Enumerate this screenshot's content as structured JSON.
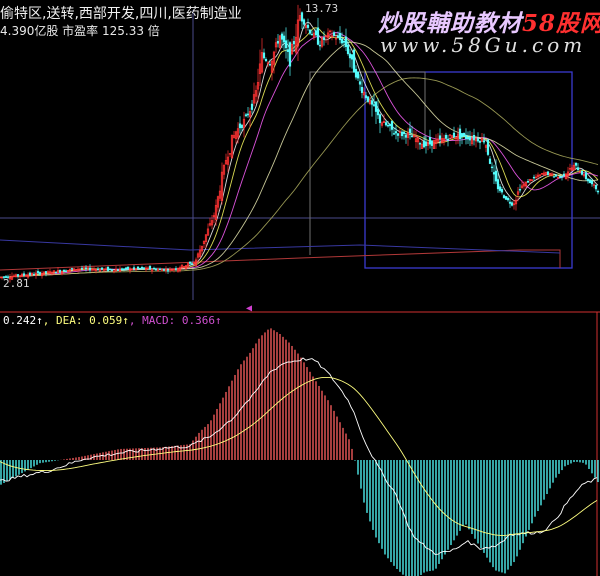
{
  "header": {
    "concepts": "偷特区,送转,西部开发,四川,医药制造业",
    "capital": "4.390亿股 市盈率 125.33 倍"
  },
  "watermark": {
    "brand_prefix": "炒股輔助教材",
    "brand_suffix": "58股网",
    "url": "www.58Gu.com",
    "prefix_color": "#e8c8ff",
    "suffix_color": "#ff3030",
    "url_color": "#e0e0e0"
  },
  "price_labels": {
    "high": "13.73",
    "low": "2.81"
  },
  "macd_legend": [
    {
      "text": "0.242↑",
      "color": "#ffffff"
    },
    {
      "text": ", DEA: 0.059↑",
      "color": "#ffff80"
    },
    {
      "text": ", MACD: 0.366↑",
      "color": "#d050d0"
    }
  ],
  "colors": {
    "background": "#000000",
    "up_candle": "#ff3232",
    "down_candle": "#54fcfc",
    "macd_positive": "#ff6060",
    "macd_negative": "#54fcfc",
    "dif_line": "#ffffff",
    "dea_line": "#ffff80",
    "separator": "#d03030",
    "marker": "#d040d0"
  },
  "chart_data": [
    {
      "type": "line",
      "panel": "candlestick price",
      "y_high": 13.73,
      "y_low": 2.81,
      "x": [
        0,
        25,
        50,
        80,
        110,
        140,
        170,
        195,
        205,
        215,
        225,
        235,
        245,
        255,
        262,
        270,
        280,
        290,
        300,
        310,
        320,
        330,
        345,
        360,
        370,
        380,
        395,
        410,
        425,
        440,
        455,
        470,
        485,
        495,
        505,
        513,
        520,
        530,
        545,
        560,
        575,
        590,
        598
      ],
      "series": [
        {
          "values": [
            3.0,
            3.1,
            3.2,
            3.35,
            3.3,
            3.35,
            3.3,
            3.6,
            4.6,
            5.6,
            7.6,
            8.8,
            9.3,
            10.2,
            11.9,
            11.6,
            12.7,
            11.7,
            13.5,
            12.9,
            12.4,
            12.8,
            12.4,
            10.7,
            10.0,
            9.3,
            8.8,
            8.7,
            8.3,
            8.5,
            8.7,
            8.6,
            8.5,
            6.8,
            6.2,
            5.9,
            6.6,
            6.9,
            7.2,
            7.0,
            7.5,
            6.8,
            6.5
          ]
        }
      ]
    },
    {
      "type": "bar",
      "panel": "MACD histogram",
      "x": [
        0,
        40,
        80,
        120,
        160,
        190,
        200,
        210,
        220,
        230,
        240,
        250,
        260,
        270,
        280,
        290,
        300,
        310,
        320,
        330,
        340,
        350,
        355,
        365,
        375,
        385,
        395,
        405,
        415,
        425,
        435,
        445,
        455,
        465,
        475,
        485,
        495,
        505,
        515,
        525,
        535,
        545,
        555,
        565,
        575,
        585,
        598
      ],
      "series": [
        {
          "values": [
            -0.08,
            -0.01,
            0.01,
            0.035,
            0.04,
            0.05,
            0.09,
            0.12,
            0.18,
            0.24,
            0.3,
            0.34,
            0.39,
            0.42,
            0.4,
            0.37,
            0.33,
            0.28,
            0.23,
            0.18,
            0.12,
            0.06,
            -0.002,
            -0.15,
            -0.24,
            -0.3,
            -0.34,
            -0.37,
            -0.38,
            -0.355,
            -0.35,
            -0.3,
            -0.25,
            -0.2,
            -0.25,
            -0.3,
            -0.35,
            -0.36,
            -0.32,
            -0.25,
            -0.18,
            -0.12,
            -0.06,
            -0.02,
            -0.005,
            -0.01,
            -0.07
          ]
        }
      ]
    }
  ]
}
